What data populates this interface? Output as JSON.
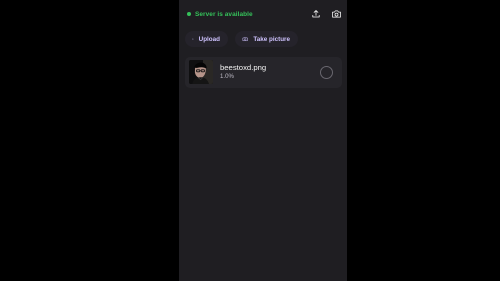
{
  "status": {
    "text": "Server is available",
    "color": "#35c15a"
  },
  "top_actions": {
    "upload_icon": "upload-icon",
    "camera_icon": "camera-icon"
  },
  "actions": {
    "upload_label": "Upload",
    "take_picture_label": "Take picture",
    "accent": "#cfc3ff"
  },
  "files": [
    {
      "name": "beestoxd.png",
      "progress": "1.0%"
    }
  ]
}
